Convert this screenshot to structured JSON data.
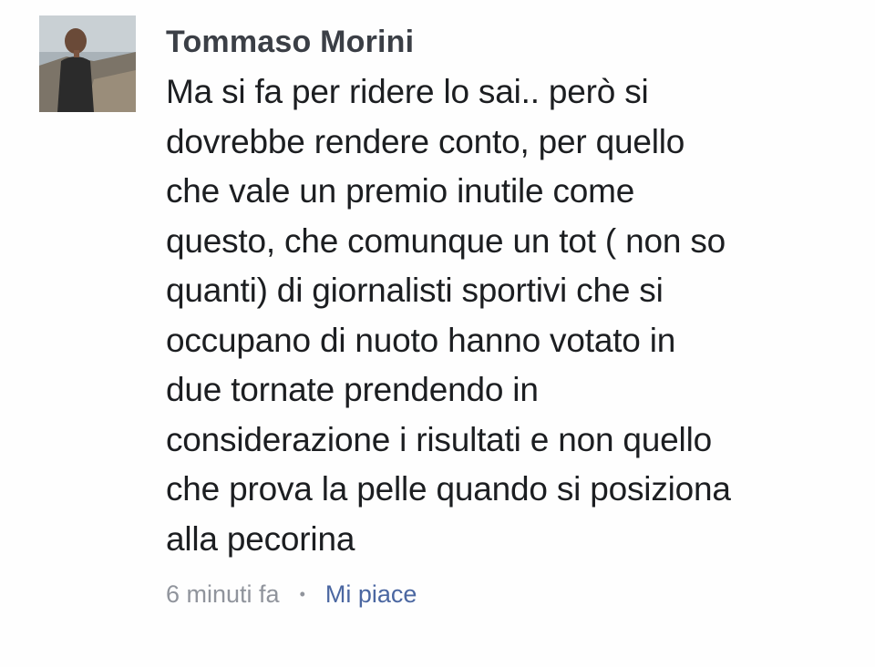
{
  "comment": {
    "author": "Tommaso Morini",
    "text": "Ma si fa per ridere lo sai.. però si\ndovrebbe rendere conto, per quello\nche vale un premio inutile come\nquesto, che comunque un tot ( non so\nquanti) di giornalisti sportivi che si\noccupano di nuoto hanno votato in\ndue tornate prendendo in\nconsiderazione i risultati e non quello\nche prova la pelle quando si posiziona\nalla pecorina",
    "timestamp": "6 minuti fa",
    "separator": "•",
    "like_label": "Mi piace"
  },
  "colors": {
    "author": "#3b3f46",
    "text": "#1c1e21",
    "meta": "#90949c",
    "link": "#4b67a1"
  }
}
